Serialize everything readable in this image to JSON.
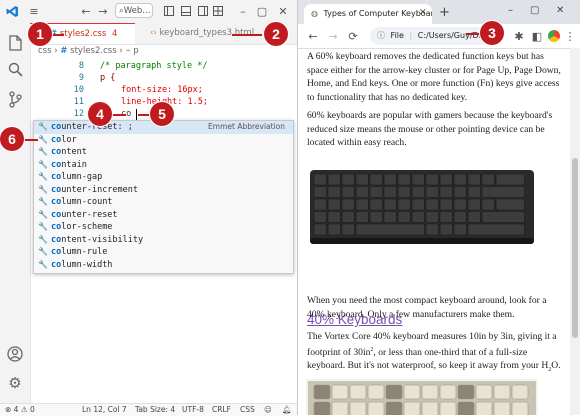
{
  "vscode": {
    "search_label": "Web...",
    "tabs": [
      {
        "label": "styles2.css",
        "badge": "4",
        "active": true
      },
      {
        "label": "keyboard_types3.html",
        "active": false
      }
    ],
    "breadcrumb": {
      "folder": "css",
      "sep": "›",
      "file": "styles2.css",
      "symbol": "p"
    },
    "code_lines": [
      {
        "num": "8",
        "text": "/* paragraph style */"
      },
      {
        "num": "9",
        "text": "p {"
      },
      {
        "num": "10",
        "text": "font-size: 16px;"
      },
      {
        "num": "11",
        "text": "line-height: 1.5;"
      },
      {
        "num": "12",
        "text": "co"
      }
    ],
    "suggest_detail": "Emmet Abbreviation",
    "suggestions": [
      "counter-reset: ;",
      "color",
      "content",
      "contain",
      "column-gap",
      "counter-increment",
      "column-count",
      "counter-reset",
      "color-scheme",
      "content-visibility",
      "column-rule",
      "column-width"
    ],
    "suggest_match": "co",
    "status": {
      "errors": "4",
      "warnings": "0",
      "position": "Ln 12, Col 7",
      "tab_size": "Tab Size: 4",
      "encoding": "UTF-8",
      "eol": "CRLF",
      "language": "CSS"
    }
  },
  "chrome": {
    "tab_title": "Types of Computer Keyboards",
    "omnibox_label": "File",
    "omnibox_url": "C:/Users/Guy/Dro",
    "para1": "A 60% keyboard removes the dedicated function keys but has space either for the arrow-key cluster or for Page Up, Page Down, Home, and End keys. One or more function (Fn) keys give access to functionality that has no dedicated key.",
    "para2": "60% keyboards are popular with gamers because the keyboard's reduced size means the mouse or other pointing device can be located within easy reach.",
    "heading": "40% Keyboards",
    "para3": "When you need the most compact keyboard around, look for a 40% keyboard. Only a few manufacturers make them.",
    "para4_a": "The Vortex Core 40% keyboard measures 10in by 3in, giving it a footprint of 30in",
    "para4_sup": "2",
    "para4_b": ", or less than one-third that of a full-size keyboard. But it's not waterproof, so keep it away from your H",
    "para4_sub": "2",
    "para4_c": "O."
  },
  "callouts": [
    "1",
    "2",
    "3",
    "4",
    "5",
    "6"
  ],
  "colors": {
    "callout": "#c01c20",
    "link_heading": "#7b4dae",
    "active_tab": "#c72e0f"
  }
}
